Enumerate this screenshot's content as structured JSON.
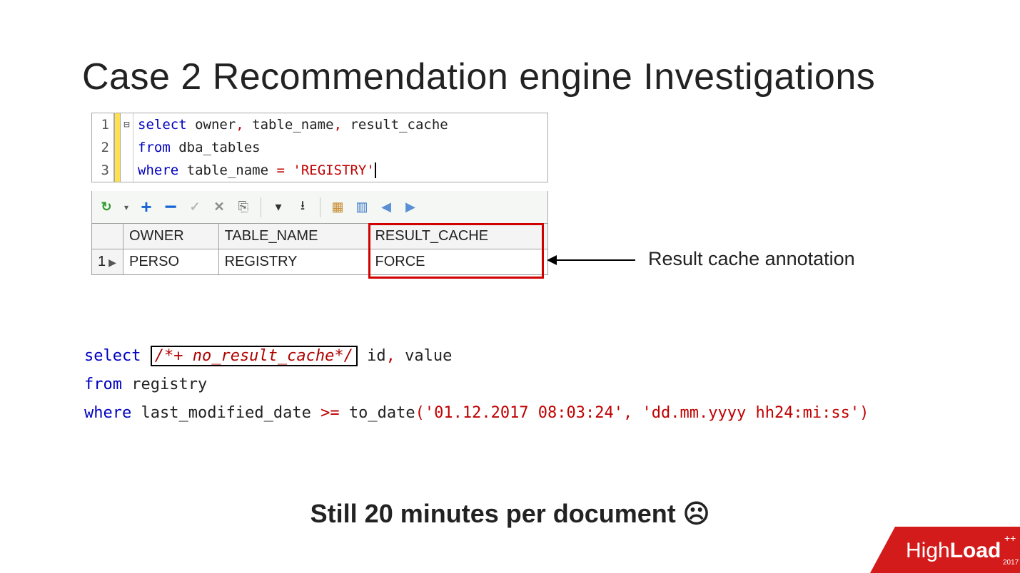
{
  "title": "Case 2 Recommendation engine Investigations",
  "editor": {
    "lines": [
      {
        "n": "1",
        "fold": "⊟",
        "text_kw1": "select",
        "text_rest1": " owner",
        "comma1": ",",
        "text_rest2": " table_name",
        "comma2": ",",
        "text_rest3": " result_cache"
      },
      {
        "n": "2",
        "text_kw1": "from",
        "text_rest1": " dba_tables"
      },
      {
        "n": "3",
        "text_kw1": "where",
        "text_rest1": " table_name ",
        "op": "=",
        "str": " 'REGISTRY'"
      }
    ]
  },
  "toolbar": {
    "refresh": "↻",
    "dropdown": "▾",
    "plus": "+",
    "minus": "−",
    "check": "✓",
    "x": "✕",
    "commit": "⎘",
    "down": "▾",
    "endrow": "⭳",
    "grid1": "▦",
    "grid2": "▥",
    "prev": "◀",
    "next": "▶"
  },
  "grid": {
    "headers": [
      "",
      "OWNER",
      "TABLE_NAME",
      "RESULT_CACHE"
    ],
    "rows": [
      {
        "n": "1",
        "owner": "PERSO",
        "table_name": "REGISTRY",
        "result_cache": "FORCE"
      }
    ]
  },
  "annotation": "Result cache annotation",
  "query2": {
    "select_kw": "select",
    "hint": "/*+ no_result_cache*/",
    "cols1": " id",
    "comma": ",",
    "cols2": " value",
    "from_kw": "from",
    "from_tbl": " registry",
    "where_kw": "where",
    "where_col": " last_modified_date ",
    "op": ">=",
    "fn": " to_date",
    "paren_open": "(",
    "arg1": "'01.12.2017 08:03:24'",
    "argsep": ",",
    "arg2": " 'dd.mm.yyyy hh24:mi:ss'",
    "paren_close": ")"
  },
  "stinger": "Still 20 minutes per document ☹",
  "logo": {
    "high": "High",
    "load": "Load",
    "plus": "++",
    "year": "2017"
  }
}
